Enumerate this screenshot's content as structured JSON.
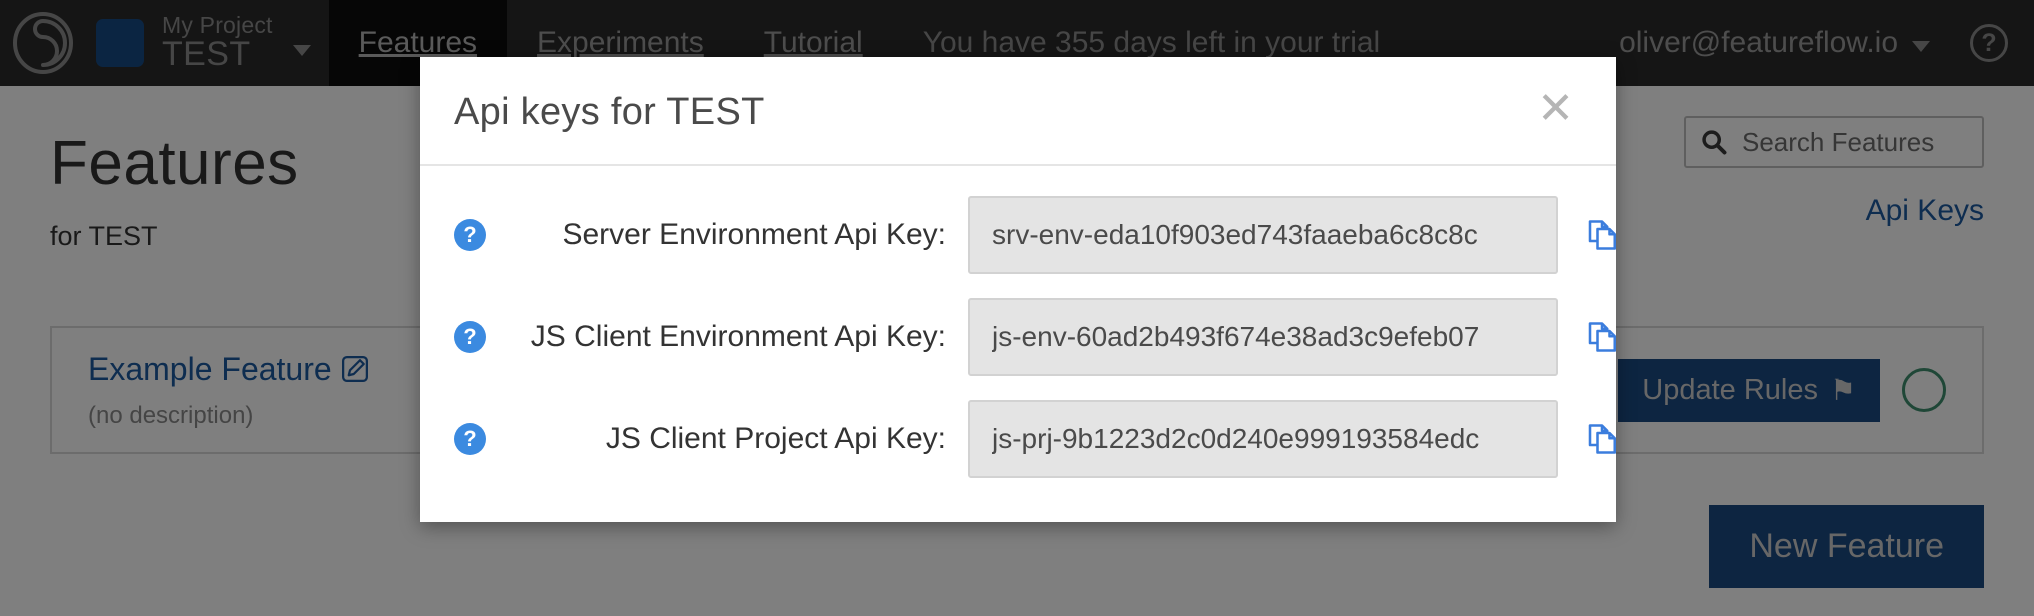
{
  "navbar": {
    "logo_name": "featureflow-logo-icon",
    "project_label": "My Project",
    "project_name": "TEST",
    "project_color": "#174a85",
    "links": [
      {
        "label": "Features",
        "active": true
      },
      {
        "label": "Experiments",
        "active": false
      },
      {
        "label": "Tutorial",
        "active": false
      }
    ],
    "trial_notice": "You have 355 days left in your trial",
    "user_email": "oliver@featureflow.io",
    "help_label": "?"
  },
  "page": {
    "title": "Features",
    "subtitle": "for TEST",
    "api_keys_link": "Api Keys"
  },
  "search": {
    "placeholder": "Search Features",
    "value": ""
  },
  "feature_card": {
    "name": "Example Feature",
    "description": "(no description)",
    "toggle_state": "OFF",
    "update_button": "Update Rules",
    "flag_glyph": "⚑"
  },
  "new_feature_button": "New Feature",
  "modal": {
    "title": "Api keys for TEST",
    "close_glyph": "✕",
    "help_glyph": "?",
    "rows": [
      {
        "label": "Server Environment Api Key:",
        "value": "srv-env-eda10f903ed743faaeba6c8c8c",
        "copy_icon": "copy-icon"
      },
      {
        "label": "JS Client Environment Api Key:",
        "value": "js-env-60ad2b493f674e38ad3c9efeb07",
        "copy_icon": "copy-icon"
      },
      {
        "label": "JS Client Project Api Key:",
        "value": "js-prj-9b1223d2c0d240e999193584edc",
        "copy_icon": "copy-icon"
      }
    ]
  },
  "colors": {
    "navbar_bg": "#2b2b2b",
    "accent_blue": "#1b4a82",
    "link_blue": "#1c5aa0",
    "help_blue": "#3b8ae0",
    "status_green": "#3f8f6f"
  }
}
